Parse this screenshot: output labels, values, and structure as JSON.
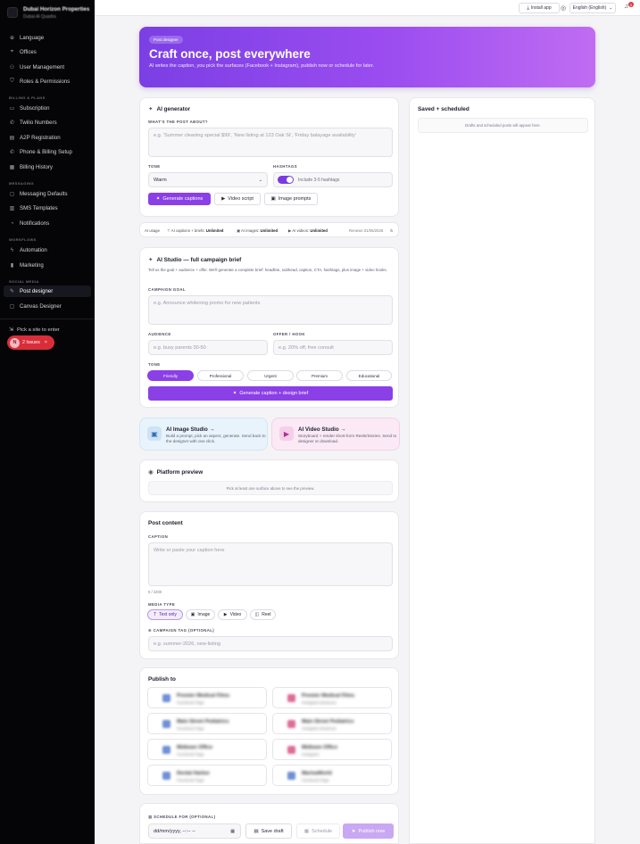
{
  "brand": {
    "name": "Dubai Horizon Properties",
    "sub": "Dubai Al Quadra"
  },
  "sidebar": {
    "items": [
      {
        "label": "Language",
        "icon": "globe-icon"
      },
      {
        "label": "Offices",
        "icon": "pin-icon"
      },
      {
        "label": "User Management",
        "icon": "users-icon"
      },
      {
        "label": "Roles & Permissions",
        "icon": "shield-icon"
      }
    ],
    "billing_section": "BILLING & PLANS",
    "billing": [
      {
        "label": "Subscription",
        "icon": "card-icon"
      },
      {
        "label": "Twilio Numbers",
        "icon": "phone-icon"
      },
      {
        "label": "A2P Registration",
        "icon": "doc-icon"
      },
      {
        "label": "Phone & Billing Setup",
        "icon": "phone-icon"
      },
      {
        "label": "Billing History",
        "icon": "receipt-icon"
      }
    ],
    "messaging_section": "MESSAGING",
    "messaging": [
      {
        "label": "Messaging Defaults",
        "icon": "chat-icon"
      },
      {
        "label": "SMS Templates",
        "icon": "template-icon"
      },
      {
        "label": "Notifications",
        "icon": "bell-icon"
      }
    ],
    "workflows_section": "WORKFLOWS",
    "workflows": [
      {
        "label": "Automation",
        "icon": "bolt-icon"
      },
      {
        "label": "Marketing",
        "icon": "chart-icon"
      }
    ],
    "social_section": "SOCIAL MEDIA",
    "social": [
      {
        "label": "Post designer",
        "icon": "pen-icon"
      },
      {
        "label": "Canvas Designer",
        "icon": "canvas-icon"
      }
    ],
    "pick_site": "Pick a site to enter",
    "issues_avatar": "N",
    "issues_label": "2 Issues",
    "issues_close": "×"
  },
  "topbar": {
    "install_label": "Install app",
    "language_label": "English (English)",
    "notification_count": "0"
  },
  "hero": {
    "pill": "Post designer",
    "title": "Craft once, post everywhere",
    "subtitle": "AI writes the caption, you pick the surfaces (Facebook + Instagram), publish now or schedule for later."
  },
  "ai_generator": {
    "title": "AI generator",
    "question_label": "WHAT'S THE POST ABOUT?",
    "question_placeholder": "e.g. 'Summer cleaning special $99', 'New listing at 123 Oak St', 'Friday balayage availability'",
    "tone_label": "TONE",
    "tone_value": "Warm",
    "hashtags_label": "HASHTAGS",
    "hashtags_text": "Include 3-5 hashtags",
    "btn_generate": "Generate captions",
    "btn_video": "Video script",
    "btn_image": "Image prompts"
  },
  "usage": {
    "label": "AI usage",
    "captions_label": "AI captions + briefs:",
    "captions_value": "Unlimited",
    "images_label": "AI images:",
    "images_value": "Unlimited",
    "videos_label": "AI videos:",
    "videos_value": "Unlimited",
    "renews": "Renews 01/06/2026"
  },
  "studio": {
    "title": "AI Studio — full campaign brief",
    "desc": "Tell us the goal + audience + offer. We'll generate a complete brief: headline, subhead, caption, CTA, hashtags, plus image + video hooks.",
    "goal_label": "CAMPAIGN GOAL",
    "goal_placeholder": "e.g. Announce whitening promo for new patients",
    "audience_label": "AUDIENCE",
    "audience_placeholder": "e.g. busy parents 30-50",
    "offer_label": "OFFER / HOOK",
    "offer_placeholder": "e.g. 20% off, free consult",
    "tone_label": "TONE",
    "tones": [
      "Friendly",
      "Professional",
      "Urgent",
      "Premium",
      "Educational"
    ],
    "btn": "Generate caption + design brief"
  },
  "image_studio": {
    "title": "AI Image Studio →",
    "desc": "Build a prompt, pick an aspect, generate. Send back to the designer with one click."
  },
  "video_studio": {
    "title": "AI Video Studio →",
    "desc": "Storyboard + render short-form Reels/Stories. Send to designer or download."
  },
  "preview": {
    "title": "Platform preview",
    "empty": "Pick at least one surface above to see the preview."
  },
  "post_content": {
    "title": "Post content",
    "caption_label": "CAPTION",
    "caption_placeholder": "Write or paste your caption here",
    "counter": "0 / 2200",
    "media_label": "MEDIA TYPE",
    "media": [
      {
        "label": "Text only",
        "icon": "text-icon"
      },
      {
        "label": "Image",
        "icon": "image-icon"
      },
      {
        "label": "Video",
        "icon": "video-icon"
      },
      {
        "label": "Reel",
        "icon": "reel-icon"
      }
    ],
    "tag_label": "CAMPAIGN TAG (OPTIONAL)",
    "tag_placeholder": "e.g. summer-2026, new-listing"
  },
  "publish": {
    "title": "Publish to",
    "accounts": [
      {
        "name": "Premier Medical Films",
        "type": "Facebook Page",
        "color": "#6f8fd6"
      },
      {
        "name": "Premier Medical Films",
        "type": "Instagram Business",
        "color": "#e06b96"
      },
      {
        "name": "Main Street Pediatrics",
        "type": "Facebook Page",
        "color": "#6f8fd6"
      },
      {
        "name": "Main Street Pediatrics",
        "type": "Instagram Business",
        "color": "#e06b96"
      },
      {
        "name": "Midtown Office",
        "type": "Facebook Page",
        "color": "#6f8fd6"
      },
      {
        "name": "Midtown Office",
        "type": "Instagram",
        "color": "#e06b96"
      },
      {
        "name": "Dental Harbor",
        "type": "Facebook Page",
        "color": "#6f8fd6"
      },
      {
        "name": "MarinaWorld",
        "type": "Facebook Page",
        "color": "#6f8fd6"
      }
    ]
  },
  "schedule": {
    "label": "SCHEDULE FOR (OPTIONAL)",
    "date_placeholder": "dd/mm/yyyy, --:-- --",
    "save_draft": "Save draft",
    "schedule": "Schedule",
    "publish_now": "Publish now"
  },
  "saved": {
    "title": "Saved + scheduled",
    "empty": "Drafts and scheduled posts will appear here."
  },
  "colors": {
    "accent": "#8b3fe6",
    "sidebar_bg": "#050507",
    "danger": "#d92d3a"
  }
}
